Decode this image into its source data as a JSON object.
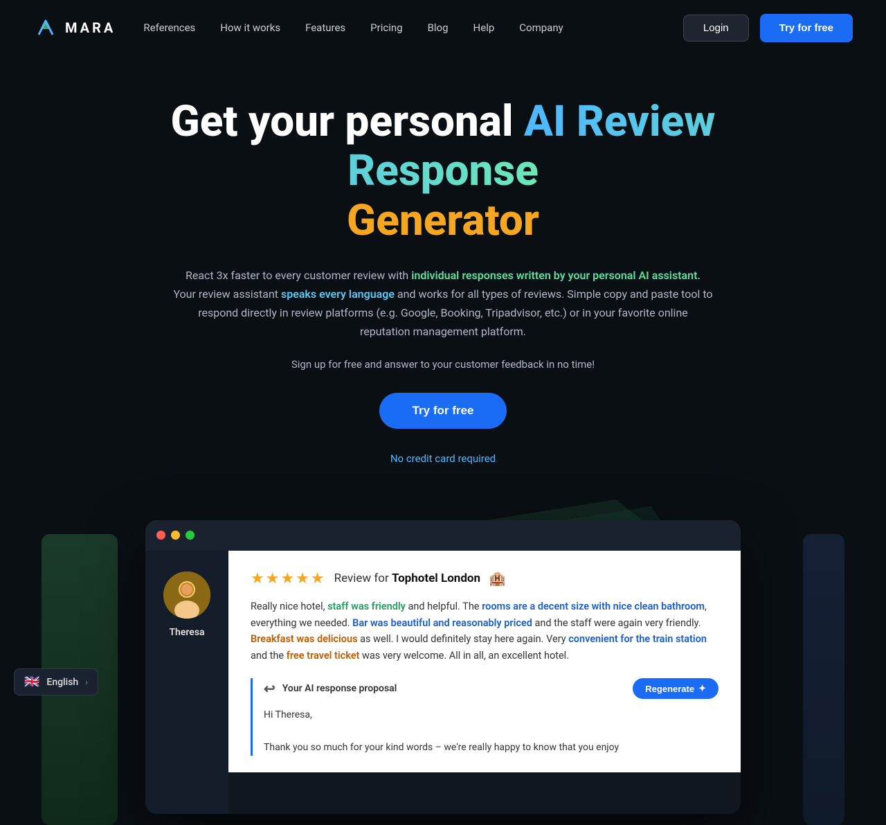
{
  "nav": {
    "logo_text": "MARA",
    "links": [
      {
        "label": "References",
        "id": "references"
      },
      {
        "label": "How it works",
        "id": "how-it-works"
      },
      {
        "label": "Features",
        "id": "features"
      },
      {
        "label": "Pricing",
        "id": "pricing"
      },
      {
        "label": "Blog",
        "id": "blog"
      },
      {
        "label": "Help",
        "id": "help"
      },
      {
        "label": "Company",
        "id": "company"
      }
    ],
    "login_label": "Login",
    "try_label": "Try for free"
  },
  "hero": {
    "title_start": "Get your personal ",
    "title_gradient": "AI Review Response",
    "title_orange": "Generator",
    "subtitle_part1": "React 3x faster to every customer review with ",
    "subtitle_highlight1": "individual responses written by your personal AI assistant.",
    "subtitle_part2": "Your review assistant ",
    "subtitle_highlight2": "speaks every language",
    "subtitle_part3": " and works for all types of reviews. Simple copy and paste tool to respond directly in review platforms (e.g. Google, Booking, Tripadvisor, etc.) or in your favorite online reputation management platform.",
    "signup_text": "Sign up for free and answer to your customer feedback in no time!",
    "try_label": "Try for free",
    "no_cc": "No credit card required"
  },
  "card": {
    "window_dots": [
      "red",
      "yellow",
      "green"
    ],
    "avatar_name": "Theresa",
    "review_stars": "★★★★★",
    "review_for": "Review for",
    "hotel_name": "Tophotel London",
    "review_text_1": "Really nice hotel, ",
    "review_hl_1": "staff was friendly",
    "review_text_2": " and helpful. The ",
    "review_hl_2": "rooms are a decent size with nice clean bathroom",
    "review_text_3": ", everything we needed. ",
    "review_hl_3": "Bar was beautiful and reasonably priced",
    "review_text_4": " and the staff were again very friendly. ",
    "review_hl_4": "Breakfast was delicious",
    "review_text_5": " as well. I would definitely stay here again. Very ",
    "review_hl_5": "convenient for the train station",
    "review_text_6": " and the ",
    "review_hl_6": "free travel ticket",
    "review_text_7": " was very welcome. All in all, an excellent hotel.",
    "ai_label": "Your AI response proposal",
    "regenerate_label": "Regenerate",
    "ai_response_1": "Hi Theresa,",
    "ai_response_2": "Thank you so much for your kind words – we're really happy to know that you enjoy"
  },
  "lang": {
    "flag": "🇬🇧",
    "label": "English",
    "chevron": "›"
  }
}
